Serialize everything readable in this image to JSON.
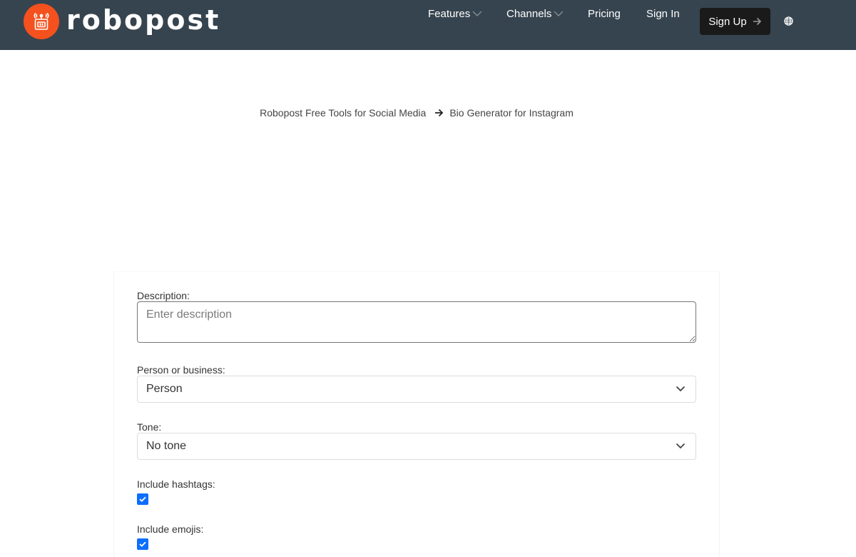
{
  "header": {
    "logo_text": "robopost",
    "nav": [
      {
        "label": "Features",
        "has_dropdown": true
      },
      {
        "label": "Channels",
        "has_dropdown": true
      },
      {
        "label": "Pricing",
        "has_dropdown": false
      },
      {
        "label": "Sign In",
        "has_dropdown": false
      }
    ],
    "signup_label": "Sign Up",
    "language_icon": "globe-icon"
  },
  "breadcrumb": {
    "parent": "Robopost Free Tools for Social Media",
    "separator_icon": "arrow-right-icon",
    "current": "Bio Generator for Instagram"
  },
  "form": {
    "description": {
      "label": "Description:",
      "placeholder": "Enter description",
      "value": ""
    },
    "person_or_business": {
      "label": "Person or business:",
      "selected": "Person"
    },
    "tone": {
      "label": "Tone:",
      "selected": "No tone"
    },
    "include_hashtags": {
      "label": "Include hashtags:",
      "checked": true
    },
    "include_emojis": {
      "label": "Include emojis:",
      "checked": true
    }
  },
  "colors": {
    "header_bg": "#36444f",
    "logo_orange": "#f4511e",
    "signup_bg": "#1a1a1a",
    "checkbox_blue": "#0d6efd"
  }
}
